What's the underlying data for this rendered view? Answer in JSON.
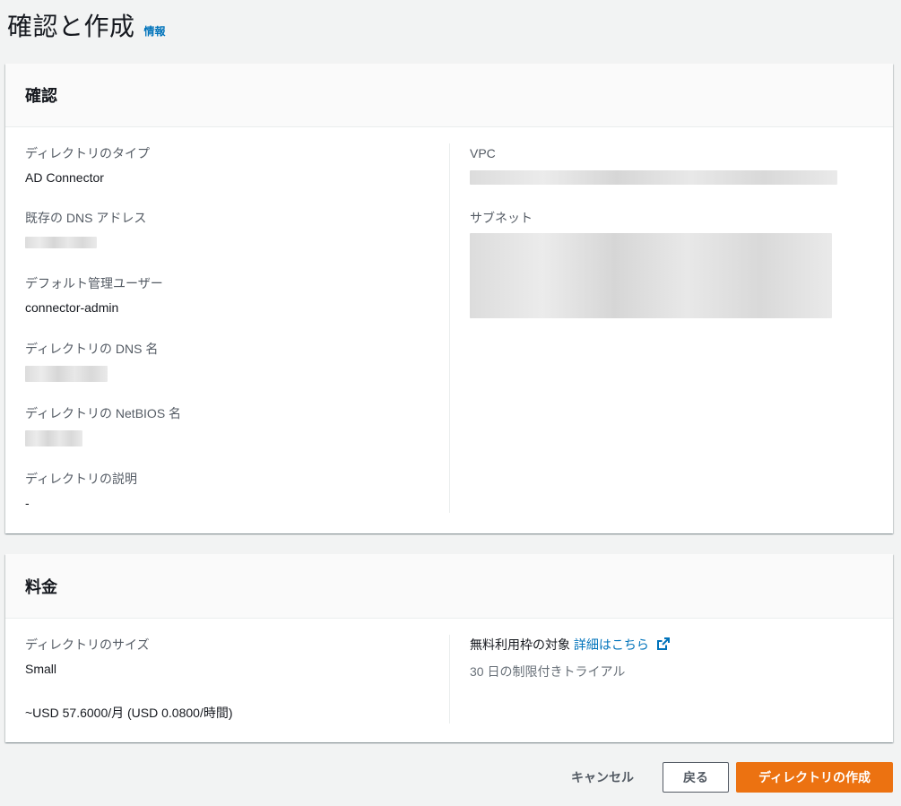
{
  "header": {
    "title": "確認と作成",
    "info_label": "情報"
  },
  "review": {
    "title": "確認",
    "left": {
      "directory_type_label": "ディレクトリのタイプ",
      "directory_type_value": "AD Connector",
      "dns_address_label": "既存の DNS アドレス",
      "default_admin_label": "デフォルト管理ユーザー",
      "default_admin_value": "connector-admin",
      "dns_name_label": "ディレクトリの DNS 名",
      "netbios_label": "ディレクトリの NetBIOS 名",
      "description_label": "ディレクトリの説明",
      "description_value": "-"
    },
    "right": {
      "vpc_label": "VPC",
      "subnet_label": "サブネット"
    }
  },
  "pricing": {
    "title": "料金",
    "size_label": "ディレクトリのサイズ",
    "size_value": "Small",
    "price_value": "~USD 57.6000/月 (USD 0.0800/時間)",
    "free_tier_label": "無料利用枠の対象",
    "details_link": "詳細はこちら",
    "trial_text": "30 日の制限付きトライアル"
  },
  "footer": {
    "cancel_label": "キャンセル",
    "back_label": "戻る",
    "create_label": "ディレクトリの作成"
  },
  "colors": {
    "accent_orange": "#ec7211",
    "link_blue": "#0073bb",
    "background": "#f2f3f3"
  },
  "icons": {
    "external_link": "external-link-icon"
  }
}
